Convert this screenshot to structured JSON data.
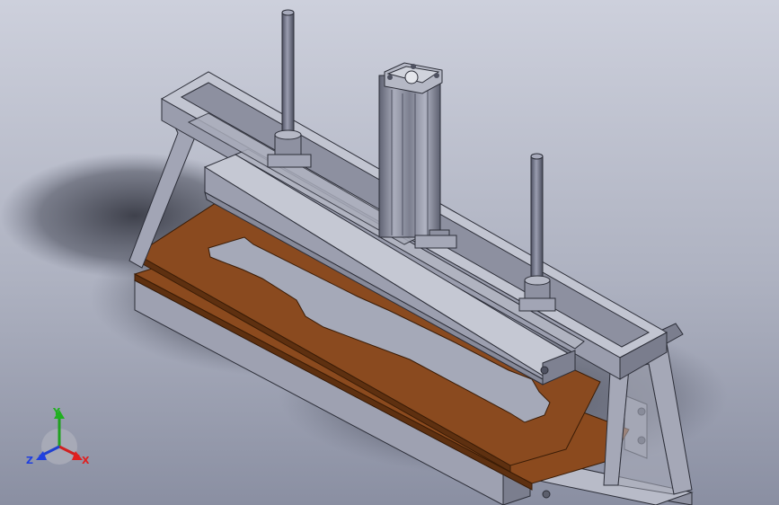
{
  "colors": {
    "background_top": "#c9ccd8",
    "background_bottom": "#888da0",
    "frame_light": "#b6b8c6",
    "frame_mid": "#9b9eae",
    "frame_dark": "#6e7182",
    "edge": "#2c2e38",
    "wood_top": "#8a4a1f",
    "wood_edge": "#5e3010",
    "rod": "#6f7284",
    "cylinder": "#8c8f9e",
    "axis_x": "#e02020",
    "axis_y": "#20b020",
    "axis_z": "#2040e0"
  },
  "triad": {
    "x_label": "X",
    "y_label": "Y",
    "z_label": "Z"
  }
}
